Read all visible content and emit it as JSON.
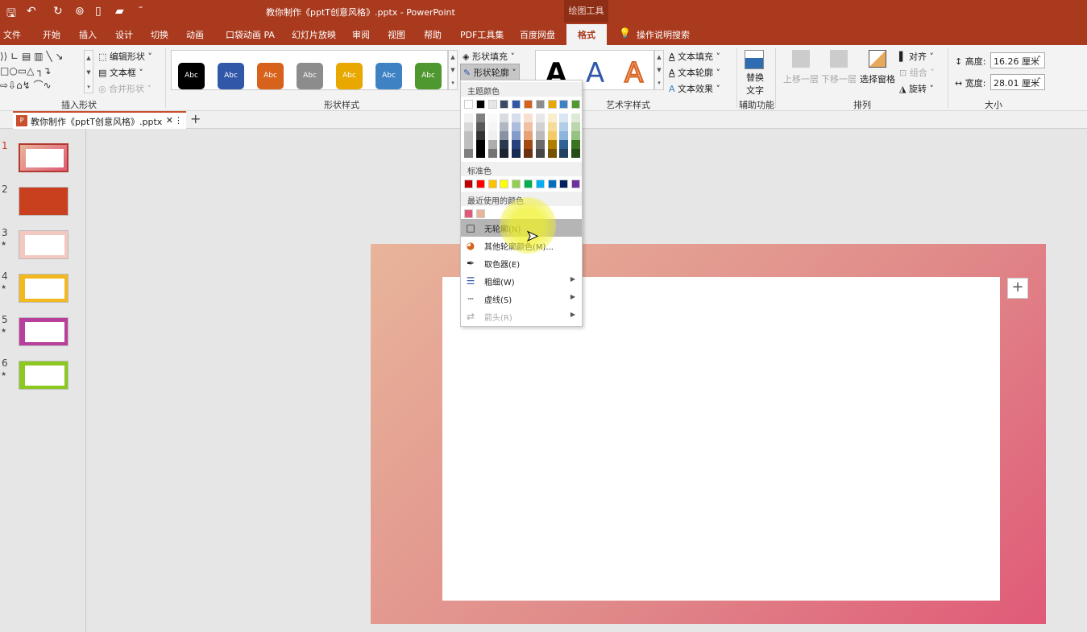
{
  "titlebar": {
    "title": "教你制作《pptT创意风格》.pptx  -  PowerPoint",
    "context_tab": "绘图工具"
  },
  "tabs": [
    {
      "label": "文件"
    },
    {
      "label": "开始"
    },
    {
      "label": "插入"
    },
    {
      "label": "设计"
    },
    {
      "label": "切换"
    },
    {
      "label": "动画"
    },
    {
      "label": "口袋动画 PA"
    },
    {
      "label": "幻灯片放映"
    },
    {
      "label": "审阅"
    },
    {
      "label": "视图"
    },
    {
      "label": "帮助"
    },
    {
      "label": "PDF工具集"
    },
    {
      "label": "百度网盘"
    },
    {
      "label": "格式",
      "active": true
    },
    {
      "label": "操作说明搜索"
    }
  ],
  "ribbon": {
    "insert_shapes": {
      "edit_shape": "编辑形状",
      "textbox": "文本框",
      "merge_shapes": "合并形状",
      "group_label": "插入形状"
    },
    "shape_styles": {
      "sample_text": "Abc",
      "colors": [
        "#000000",
        "#3158a8",
        "#d6621c",
        "#8c8c8c",
        "#e8a800",
        "#3f82c4",
        "#4f9830"
      ],
      "fill": "形状填充",
      "outline": "形状轮廓",
      "group_label": "形状样式"
    },
    "wordart": {
      "letter": "A",
      "fill": "文本填充",
      "outline": "文本轮廓",
      "effects": "文本效果",
      "group_label": "艺术字样式"
    },
    "accessibility": {
      "alt_text_1": "替换",
      "alt_text_2": "文字",
      "group_label": "辅助功能"
    },
    "arrange": {
      "bring_forward": "上移一层",
      "send_backward": "下移一层",
      "selection_pane": "选择窗格",
      "align": "对齐",
      "group": "组合",
      "rotate": "旋转",
      "group_label": "排列"
    },
    "size": {
      "height_label": "高度:",
      "height_value": "16.26 厘米",
      "width_label": "宽度:",
      "width_value": "28.01 厘米",
      "group_label": "大小"
    }
  },
  "doc_tab": {
    "name": "教你制作《pptT创意风格》.pptx"
  },
  "slides": [
    {
      "num": "1",
      "star": false
    },
    {
      "num": "2",
      "star": false
    },
    {
      "num": "3",
      "star": true
    },
    {
      "num": "4",
      "star": true
    },
    {
      "num": "5",
      "star": true
    },
    {
      "num": "6",
      "star": true
    }
  ],
  "slide_colors": {
    "gradient_start": "#e8b49a",
    "gradient_end": "#e05a78"
  },
  "outline_menu": {
    "theme_header": "主题颜色",
    "theme_colors": [
      "#ffffff",
      "#000000",
      "#e7e6e6",
      "#3a4a66",
      "#3158a8",
      "#d6621c",
      "#8c8c8c",
      "#e8a800",
      "#3f82c4",
      "#4f9830"
    ],
    "standard_header": "标准色",
    "standard_colors": [
      "#c00000",
      "#ff0000",
      "#ffc000",
      "#ffff00",
      "#92d050",
      "#00b050",
      "#00b0f0",
      "#0070c0",
      "#002060",
      "#7030a0"
    ],
    "recent_header": "最近使用的颜色",
    "recent_colors": [
      "#e05a78",
      "#e8b49a"
    ],
    "items": [
      {
        "label": "无轮廓(N)",
        "icon": "no-outline-icon",
        "highlight": true
      },
      {
        "label": "其他轮廓颜色(M)...",
        "icon": "color-wheel-icon"
      },
      {
        "label": "取色器(E)",
        "icon": "eyedropper-icon"
      },
      {
        "label": "粗细(W)",
        "icon": "line-weight-icon",
        "submenu": true
      },
      {
        "label": "虚线(S)",
        "icon": "dashes-icon",
        "submenu": true
      },
      {
        "label": "箭头(R)",
        "icon": "arrows-icon",
        "submenu": true,
        "disabled": true
      }
    ]
  }
}
